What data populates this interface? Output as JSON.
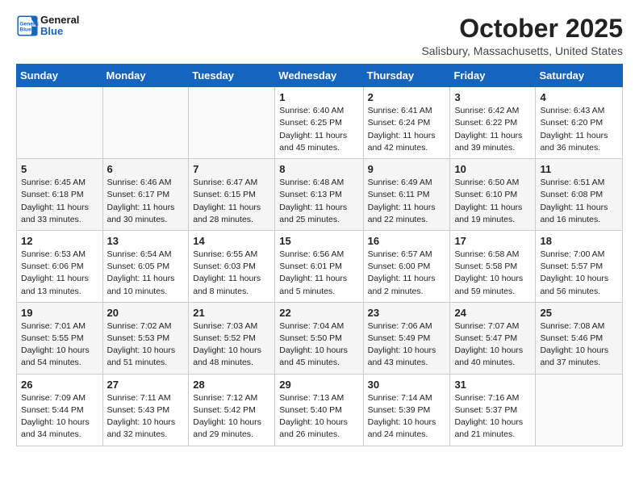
{
  "header": {
    "logo_line1": "General",
    "logo_line2": "Blue",
    "month_title": "October 2025",
    "location": "Salisbury, Massachusetts, United States"
  },
  "weekdays": [
    "Sunday",
    "Monday",
    "Tuesday",
    "Wednesday",
    "Thursday",
    "Friday",
    "Saturday"
  ],
  "weeks": [
    [
      {
        "day": "",
        "info": ""
      },
      {
        "day": "",
        "info": ""
      },
      {
        "day": "",
        "info": ""
      },
      {
        "day": "1",
        "info": "Sunrise: 6:40 AM\nSunset: 6:25 PM\nDaylight: 11 hours\nand 45 minutes."
      },
      {
        "day": "2",
        "info": "Sunrise: 6:41 AM\nSunset: 6:24 PM\nDaylight: 11 hours\nand 42 minutes."
      },
      {
        "day": "3",
        "info": "Sunrise: 6:42 AM\nSunset: 6:22 PM\nDaylight: 11 hours\nand 39 minutes."
      },
      {
        "day": "4",
        "info": "Sunrise: 6:43 AM\nSunset: 6:20 PM\nDaylight: 11 hours\nand 36 minutes."
      }
    ],
    [
      {
        "day": "5",
        "info": "Sunrise: 6:45 AM\nSunset: 6:18 PM\nDaylight: 11 hours\nand 33 minutes."
      },
      {
        "day": "6",
        "info": "Sunrise: 6:46 AM\nSunset: 6:17 PM\nDaylight: 11 hours\nand 30 minutes."
      },
      {
        "day": "7",
        "info": "Sunrise: 6:47 AM\nSunset: 6:15 PM\nDaylight: 11 hours\nand 28 minutes."
      },
      {
        "day": "8",
        "info": "Sunrise: 6:48 AM\nSunset: 6:13 PM\nDaylight: 11 hours\nand 25 minutes."
      },
      {
        "day": "9",
        "info": "Sunrise: 6:49 AM\nSunset: 6:11 PM\nDaylight: 11 hours\nand 22 minutes."
      },
      {
        "day": "10",
        "info": "Sunrise: 6:50 AM\nSunset: 6:10 PM\nDaylight: 11 hours\nand 19 minutes."
      },
      {
        "day": "11",
        "info": "Sunrise: 6:51 AM\nSunset: 6:08 PM\nDaylight: 11 hours\nand 16 minutes."
      }
    ],
    [
      {
        "day": "12",
        "info": "Sunrise: 6:53 AM\nSunset: 6:06 PM\nDaylight: 11 hours\nand 13 minutes."
      },
      {
        "day": "13",
        "info": "Sunrise: 6:54 AM\nSunset: 6:05 PM\nDaylight: 11 hours\nand 10 minutes."
      },
      {
        "day": "14",
        "info": "Sunrise: 6:55 AM\nSunset: 6:03 PM\nDaylight: 11 hours\nand 8 minutes."
      },
      {
        "day": "15",
        "info": "Sunrise: 6:56 AM\nSunset: 6:01 PM\nDaylight: 11 hours\nand 5 minutes."
      },
      {
        "day": "16",
        "info": "Sunrise: 6:57 AM\nSunset: 6:00 PM\nDaylight: 11 hours\nand 2 minutes."
      },
      {
        "day": "17",
        "info": "Sunrise: 6:58 AM\nSunset: 5:58 PM\nDaylight: 10 hours\nand 59 minutes."
      },
      {
        "day": "18",
        "info": "Sunrise: 7:00 AM\nSunset: 5:57 PM\nDaylight: 10 hours\nand 56 minutes."
      }
    ],
    [
      {
        "day": "19",
        "info": "Sunrise: 7:01 AM\nSunset: 5:55 PM\nDaylight: 10 hours\nand 54 minutes."
      },
      {
        "day": "20",
        "info": "Sunrise: 7:02 AM\nSunset: 5:53 PM\nDaylight: 10 hours\nand 51 minutes."
      },
      {
        "day": "21",
        "info": "Sunrise: 7:03 AM\nSunset: 5:52 PM\nDaylight: 10 hours\nand 48 minutes."
      },
      {
        "day": "22",
        "info": "Sunrise: 7:04 AM\nSunset: 5:50 PM\nDaylight: 10 hours\nand 45 minutes."
      },
      {
        "day": "23",
        "info": "Sunrise: 7:06 AM\nSunset: 5:49 PM\nDaylight: 10 hours\nand 43 minutes."
      },
      {
        "day": "24",
        "info": "Sunrise: 7:07 AM\nSunset: 5:47 PM\nDaylight: 10 hours\nand 40 minutes."
      },
      {
        "day": "25",
        "info": "Sunrise: 7:08 AM\nSunset: 5:46 PM\nDaylight: 10 hours\nand 37 minutes."
      }
    ],
    [
      {
        "day": "26",
        "info": "Sunrise: 7:09 AM\nSunset: 5:44 PM\nDaylight: 10 hours\nand 34 minutes."
      },
      {
        "day": "27",
        "info": "Sunrise: 7:11 AM\nSunset: 5:43 PM\nDaylight: 10 hours\nand 32 minutes."
      },
      {
        "day": "28",
        "info": "Sunrise: 7:12 AM\nSunset: 5:42 PM\nDaylight: 10 hours\nand 29 minutes."
      },
      {
        "day": "29",
        "info": "Sunrise: 7:13 AM\nSunset: 5:40 PM\nDaylight: 10 hours\nand 26 minutes."
      },
      {
        "day": "30",
        "info": "Sunrise: 7:14 AM\nSunset: 5:39 PM\nDaylight: 10 hours\nand 24 minutes."
      },
      {
        "day": "31",
        "info": "Sunrise: 7:16 AM\nSunset: 5:37 PM\nDaylight: 10 hours\nand 21 minutes."
      },
      {
        "day": "",
        "info": ""
      }
    ]
  ]
}
